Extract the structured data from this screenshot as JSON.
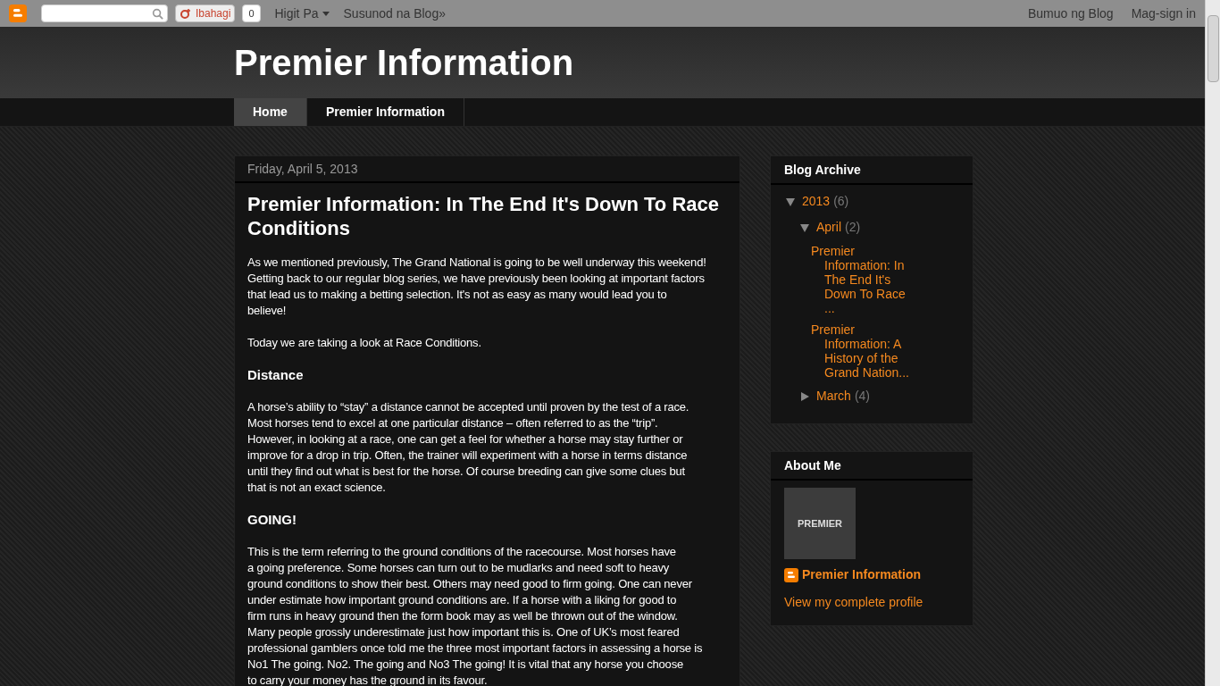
{
  "navbar": {
    "share_label": "Ibahagi",
    "share_count": "0",
    "more_label": "Higit Pa",
    "next_blog": "Susunod na Blog»",
    "create_blog": "Bumuo ng Blog",
    "sign_in": "Mag-sign in"
  },
  "header": {
    "title": "Premier Information"
  },
  "tabs": [
    {
      "label": "Home",
      "selected": true
    },
    {
      "label": "Premier Information",
      "selected": false
    }
  ],
  "post": {
    "date": "Friday, April 5, 2013",
    "title": "Premier Information: In The End It's Down To Race Conditions",
    "blocks": [
      {
        "kind": "paragraph",
        "text": "As we mentioned previously, The Grand National is going to be well underway this weekend!\nGetting back to our regular blog series, we have previously been looking at important factors\nthat lead us to making a betting selection. It's not as easy as many would lead you to\nbelieve!"
      },
      {
        "kind": "paragraph",
        "text": "Today we are taking a look at Race Conditions."
      },
      {
        "kind": "heading",
        "text": "Distance"
      },
      {
        "kind": "paragraph",
        "text": "A horse’s ability to “stay” a distance cannot be accepted until proven by the test of a race.\nMost horses tend to excel at one particular distance – often referred to as the “trip”.\nHowever, in looking at a race, one can get a feel for whether a horse may stay further or\nimprove for a drop in trip. Often, the trainer will experiment with a horse in terms distance\nuntil they find out what is best for the horse. Of course breeding can give some clues but\nthat is not an exact science."
      },
      {
        "kind": "heading",
        "text": "GOING!"
      },
      {
        "kind": "paragraph",
        "text": "This is the term referring to the ground conditions of the racecourse. Most horses have\na going preference. Some horses can turn out to be mudlarks and need soft to heavy\nground conditions to show their best. Others may need good to firm going. One can never\nunder estimate how important ground conditions are. If a horse with a liking for good to\nfirm runs in heavy ground then the form book may as well be thrown out of the window.\nMany people grossly underestimate just how important this is. One of UK’s most feared\nprofessional gamblers once told me the three most important factors in assessing a horse is\nNo1 The going. No2. The going and No3 The going! It is vital that any horse you choose\nto carry your money has the ground in its favour."
      }
    ]
  },
  "blog_archive": {
    "title": "Blog Archive",
    "items": [
      {
        "label": "2013",
        "count": "(6)",
        "expanded": true,
        "children": [
          {
            "label": "April",
            "count": "(2)",
            "expanded": true,
            "posts": [
              "Premier Information: In The End It's Down To Race ...",
              "Premier Information: A History of the Grand Nation..."
            ]
          },
          {
            "label": "March",
            "count": "(4)",
            "expanded": false
          }
        ]
      }
    ]
  },
  "about_me": {
    "title": "About Me",
    "avatar_text": "PREMIER",
    "name": "Premier Information",
    "profile_link": "View my complete profile"
  }
}
